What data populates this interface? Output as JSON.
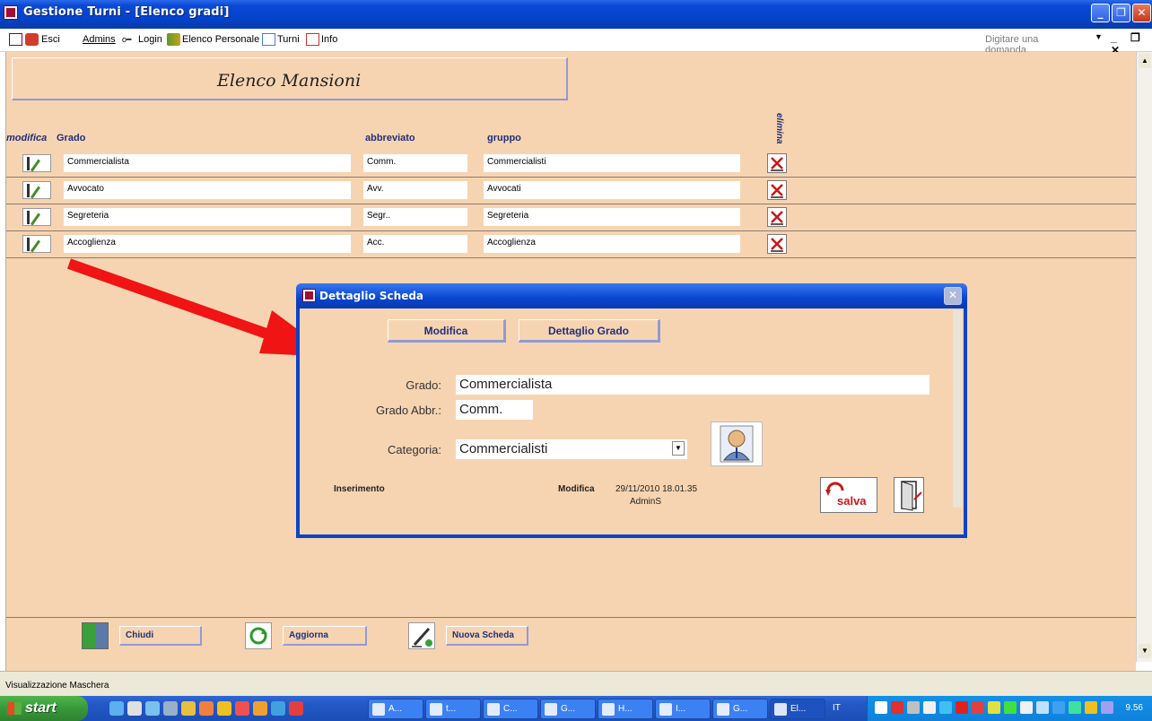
{
  "window": {
    "title": "Gestione Turni - [Elenco gradi]"
  },
  "menu": {
    "items": [
      "Esci",
      "Admins",
      "Login",
      "Elenco Personale",
      "Turni",
      "Info"
    ],
    "ask_placeholder": "Digitare una domanda."
  },
  "form": {
    "title": "Elenco Mansioni",
    "columns": {
      "modifica": "modifica",
      "grado": "Grado",
      "abbreviato": "abbreviato",
      "gruppo": "gruppo",
      "elimina": "elimina"
    },
    "rows": [
      {
        "grado": "Commercialista",
        "abbreviato": "Comm.",
        "gruppo": "Commercialisti"
      },
      {
        "grado": "Avvocato",
        "abbreviato": "Avv.",
        "gruppo": "Avvocati"
      },
      {
        "grado": "Segreteria",
        "abbreviato": "Segr..",
        "gruppo": "Segreteria"
      },
      {
        "grado": "Accoglienza",
        "abbreviato": "Acc.",
        "gruppo": "Accoglienza"
      }
    ],
    "buttons": {
      "chiudi": "Chiudi",
      "aggiorna": "Aggiorna",
      "nuova": "Nuova Scheda"
    }
  },
  "dialog": {
    "title": "Dettaglio Scheda",
    "tabs": {
      "modifica": "Modifica",
      "dettaglio": "Dettaglio Grado"
    },
    "labels": {
      "grado": "Grado:",
      "abbr": "Grado Abbr.:",
      "categoria": "Categoria:",
      "inserimento": "Inserimento",
      "modifica": "Modifica"
    },
    "values": {
      "grado": "Commercialista",
      "abbr": "Comm.",
      "categoria": "Commercialisti",
      "modifica_date": "29/11/2010 18.01.35",
      "modifica_user": "AdminS"
    },
    "salva_label": "salva"
  },
  "statusbar": {
    "text": "Visualizzazione Maschera"
  },
  "taskbar": {
    "start": "start",
    "tasks": [
      "A...",
      "t...",
      "C...",
      "G...",
      "H...",
      "I...",
      "G...",
      "El..."
    ],
    "lang": "IT",
    "clock": "9.56"
  },
  "colors": {
    "form_bg": "#f7d4b1",
    "accent_blue": "#1f2f7a",
    "title_bar": "#0a48d6"
  }
}
